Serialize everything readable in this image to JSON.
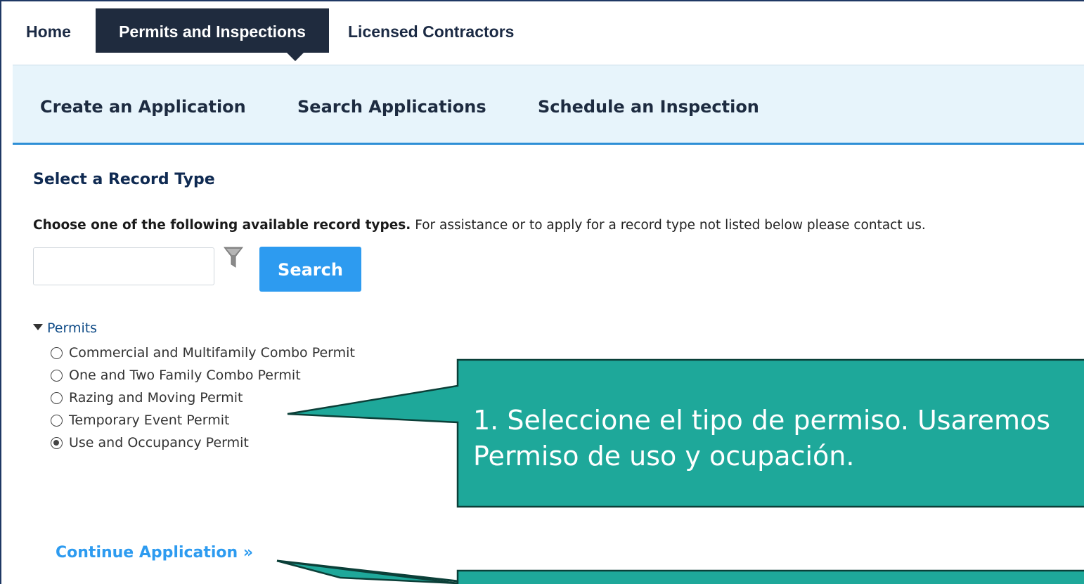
{
  "top_nav": {
    "home": "Home",
    "permits": "Permits and Inspections",
    "contractors": "Licensed Contractors"
  },
  "sub_nav": {
    "create": "Create an Application",
    "search": "Search Applications",
    "schedule": "Schedule an Inspection"
  },
  "content": {
    "heading": "Select a Record Type",
    "instructions_bold": "Choose one of the following available record types.",
    "instructions_rest": " For assistance or to apply for a record type not listed below please contact us.",
    "search_input_value": "",
    "search_button": "Search",
    "tree_root": "Permits",
    "record_types": [
      {
        "label": "Commercial and Multifamily Combo Permit",
        "selected": false
      },
      {
        "label": "One and Two Family Combo Permit",
        "selected": false
      },
      {
        "label": "Razing and Moving Permit",
        "selected": false
      },
      {
        "label": "Temporary Event Permit",
        "selected": false
      },
      {
        "label": "Use and Occupancy Permit",
        "selected": true
      }
    ],
    "continue": "Continue Application »"
  },
  "callouts": [
    {
      "line1": "1. Seleccione el tipo de permiso. Usaremos",
      "line2": "Permiso de uso y ocupación."
    },
    {
      "line1": "",
      "line2": ""
    }
  ],
  "colors": {
    "nav_active": "#1f2b3e",
    "subnav_bg": "#e7f4fb",
    "accent_blue": "#2d9bf0",
    "callout_fill": "#1ea89a",
    "callout_border": "#0b3f38"
  }
}
